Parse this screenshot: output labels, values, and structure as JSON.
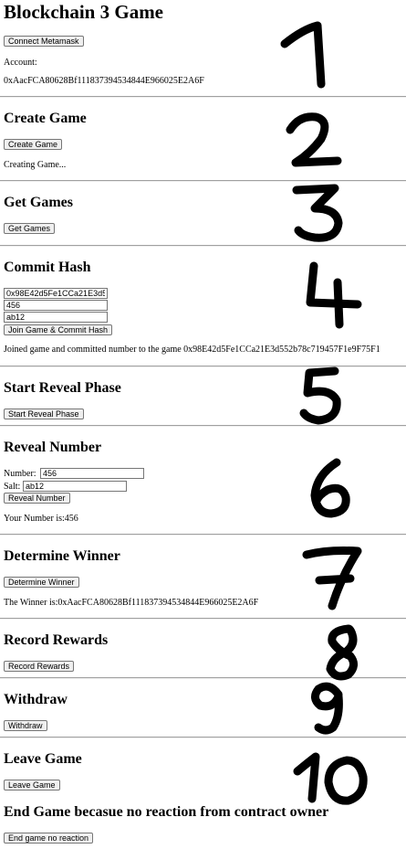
{
  "title": "Blockchain 3 Game",
  "connect": {
    "button": "Connect Metamask",
    "account_label": "Account:",
    "account_value": "0xAacFCA80628Bf111837394534844E966025E2A6F"
  },
  "create": {
    "heading": "Create Game",
    "button": "Create Game",
    "status": "Creating Game..."
  },
  "get": {
    "heading": "Get Games",
    "button": "Get Games"
  },
  "commit": {
    "heading": "Commit Hash",
    "address_value": "0x98E42d5Fe1CCa21E3d5",
    "number_value": "456",
    "salt_value": "ab12",
    "button": "Join Game & Commit Hash",
    "status": "Joined game and committed number to the game 0x98E42d5Fe1CCa21E3d552b78c719457F1e9F75F1"
  },
  "start": {
    "heading": "Start Reveal Phase",
    "button": "Start Reveal Phase"
  },
  "reveal": {
    "heading": "Reveal Number",
    "number_label": "Number:",
    "number_value": "456",
    "salt_label": "Salt:",
    "salt_value": "ab12",
    "button": "Reveal Number",
    "status": "Your Number is:456"
  },
  "winner": {
    "heading": "Determine Winner",
    "button": "Determine Winner",
    "status": "The Winner is:0xAacFCA80628Bf111837394534844E966025E2A6F"
  },
  "record": {
    "heading": "Record Rewards",
    "button": "Record Rewards"
  },
  "withdraw": {
    "heading": "Withdraw",
    "button": "Withdraw"
  },
  "leave": {
    "heading": "Leave Game",
    "button": "Leave Game"
  },
  "end": {
    "heading": "End Game becasue no reaction from contract owner",
    "button": "End game no reaction"
  },
  "annotations": [
    "1",
    "2",
    "3",
    "4",
    "5",
    "6",
    "7",
    "8",
    "9",
    "10"
  ]
}
